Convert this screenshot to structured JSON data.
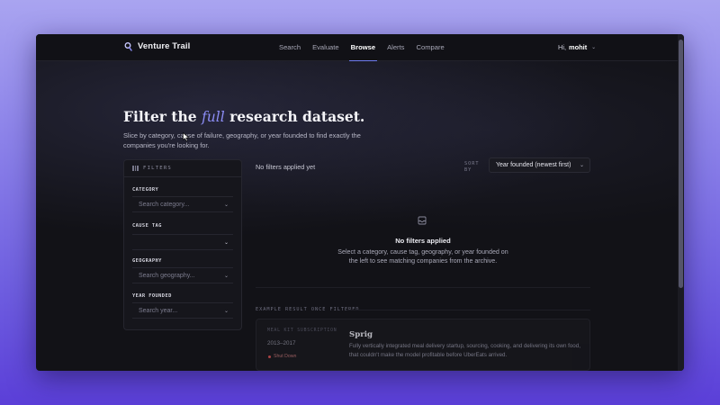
{
  "app": {
    "name": "Venture Trail"
  },
  "nav": {
    "items": [
      {
        "label": "Search",
        "active": false
      },
      {
        "label": "Evaluate",
        "active": false
      },
      {
        "label": "Browse",
        "active": true
      },
      {
        "label": "Alerts",
        "active": false
      },
      {
        "label": "Compare",
        "active": false
      }
    ]
  },
  "user": {
    "greeting": "Hi,",
    "name": "mohit"
  },
  "hero": {
    "title_before": "Filter the",
    "title_accent": "full",
    "title_after": "research dataset.",
    "subtitle": "Slice by category, cause of failure, geography, or year founded to find exactly the companies you're looking for."
  },
  "filters": {
    "title": "FILTERS",
    "groups": [
      {
        "label": "CATEGORY",
        "placeholder": "Search category..."
      },
      {
        "label": "CAUSE TAG",
        "placeholder": ""
      },
      {
        "label": "GEOGRAPHY",
        "placeholder": "Search geography..."
      },
      {
        "label": "YEAR FOUNDED",
        "placeholder": "Search year..."
      }
    ]
  },
  "results": {
    "status": "No filters applied yet",
    "sort_label": "SORT BY",
    "sort_value": "Year founded (newest first)",
    "empty_title": "No filters applied",
    "empty_desc": "Select a category, cause tag, geography, or year founded on the left to see matching companies from the archive."
  },
  "example": {
    "label": "EXAMPLE RESULT ONCE FILTERED",
    "tag": "MEAL KIT SUBSCRIPTION",
    "years": "2013–2017",
    "status": "Shut Down",
    "name": "Sprig",
    "desc": "Fully vertically integrated meal delivery startup, sourcing, cooking, and delivering its own food, that couldn't make the model profitable before UberEats arrived."
  },
  "colors": {
    "accent": "#8c8df6",
    "nav_underline": "#6f7cf0",
    "status_dot": "#d05050"
  }
}
